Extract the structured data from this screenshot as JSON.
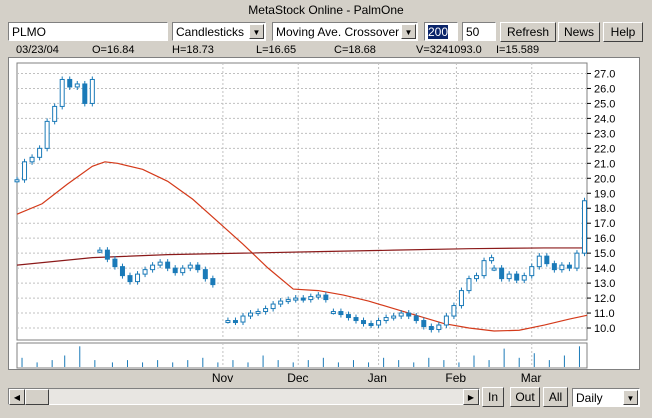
{
  "window": {
    "title": "MetaStock Online - PalmOne"
  },
  "toolbar": {
    "symbol": "PLMO",
    "chart_style": "Candlesticks",
    "indicator": "Moving Ave. Crossover",
    "period1": "200",
    "period2": "50",
    "refresh_label": "Refresh",
    "news_label": "News",
    "help_label": "Help"
  },
  "quote": {
    "date": "03/23/04",
    "open": "O=16.84",
    "high": "H=18.73",
    "low": "L=16.65",
    "close": "C=18.68",
    "volume": "V=3241093.0",
    "indicator": "I=15.589"
  },
  "bottom": {
    "in_label": "In",
    "out_label": "Out",
    "all_label": "All",
    "interval": "Daily"
  },
  "colors": {
    "price": "#1a7ab8",
    "ma_fast": "#d43a1a",
    "ma_slow": "#8b1a1a",
    "grid": "#c0c0c0",
    "volume": "#1a7ab8"
  },
  "chart_data": {
    "type": "line",
    "title": "",
    "xlabel": "",
    "ylabel": "",
    "ylim": [
      9.2,
      27.7
    ],
    "y_ticks": [
      "27.0",
      "26.0",
      "25.0",
      "24.0",
      "23.0",
      "22.0",
      "21.0",
      "20.0",
      "19.0",
      "18.0",
      "17.0",
      "16.0",
      "15.0",
      "14.0",
      "13.0",
      "12.0",
      "11.0",
      "10.0"
    ],
    "x_ticks": [
      "Nov",
      "Dec",
      "Jan",
      "Feb",
      "Mar"
    ],
    "x_tick_days": [
      82,
      112,
      144,
      175,
      205
    ],
    "day_range": [
      0,
      227
    ],
    "grid": true,
    "series": [
      {
        "kind": "ma",
        "color_key": "ma_fast",
        "days": [
          0,
          10,
          20,
          30,
          35,
          40,
          50,
          60,
          70,
          80,
          90,
          100,
          110,
          120,
          130,
          140,
          150,
          160,
          170,
          180,
          190,
          200,
          210,
          220,
          227
        ],
        "values": [
          17.6,
          18.3,
          19.6,
          20.8,
          21.1,
          21.0,
          20.6,
          19.8,
          18.6,
          17.1,
          15.6,
          14.0,
          12.6,
          12.5,
          12.2,
          11.8,
          11.3,
          10.8,
          10.3,
          10.0,
          9.8,
          9.85,
          10.2,
          10.6,
          10.85
        ]
      },
      {
        "kind": "ma",
        "color_key": "ma_slow",
        "days": [
          0,
          30,
          60,
          90,
          120,
          150,
          180,
          210,
          227
        ],
        "values": [
          14.2,
          14.7,
          14.9,
          15.0,
          15.1,
          15.2,
          15.3,
          15.35,
          15.35
        ]
      },
      {
        "kind": "price",
        "color_key": "price",
        "segments": [
          {
            "days": [
              0,
              3,
              6,
              9,
              12,
              15,
              18,
              21,
              24,
              27,
              30
            ],
            "values": [
              19.9,
              21.1,
              21.4,
              22.0,
              23.8,
              24.8,
              26.6,
              26.1,
              26.3,
              25.0,
              26.6
            ]
          },
          {
            "days": [
              33,
              36,
              39,
              42,
              45,
              48,
              51,
              54,
              57,
              60,
              63,
              66,
              69,
              72,
              75,
              78
            ],
            "values": [
              15.2,
              14.6,
              14.1,
              13.5,
              13.1,
              13.6,
              13.9,
              14.2,
              14.4,
              14.0,
              13.7,
              14.0,
              14.2,
              13.9,
              13.3,
              12.9
            ]
          },
          {
            "days": [
              84,
              87,
              90,
              93,
              96,
              99,
              102,
              105,
              108,
              111,
              114,
              117,
              120,
              123
            ],
            "values": [
              10.5,
              10.4,
              10.8,
              11.0,
              11.1,
              11.3,
              11.6,
              11.8,
              11.9,
              12.0,
              11.9,
              12.1,
              12.2,
              11.9
            ]
          },
          {
            "days": [
              126,
              129,
              132,
              135,
              138,
              141,
              144,
              147,
              150,
              153,
              156,
              159,
              162,
              165,
              168,
              171,
              174,
              177,
              180,
              183,
              186,
              189
            ],
            "values": [
              11.1,
              10.9,
              10.7,
              10.5,
              10.3,
              10.2,
              10.5,
              10.7,
              10.8,
              11.0,
              10.8,
              10.5,
              10.1,
              9.9,
              10.2,
              10.8,
              11.5,
              12.5,
              13.3,
              13.5,
              14.5,
              14.7
            ]
          },
          {
            "days": [
              190,
              193,
              196,
              199,
              202,
              205,
              208,
              211,
              214,
              217,
              220,
              223,
              226
            ],
            "values": [
              14.0,
              13.3,
              13.6,
              13.2,
              13.5,
              14.1,
              14.8,
              14.3,
              13.9,
              14.2,
              14.0,
              15.0,
              18.5
            ]
          }
        ]
      },
      {
        "kind": "volume",
        "color_key": "volume",
        "days": [
          2,
          8,
          14,
          19,
          25,
          31,
          38,
          44,
          50,
          56,
          62,
          68,
          74,
          80,
          86,
          92,
          98,
          104,
          110,
          116,
          122,
          128,
          134,
          140,
          146,
          152,
          158,
          164,
          170,
          176,
          182,
          188,
          194,
          200,
          206,
          212,
          218,
          224
        ],
        "values": [
          0.4,
          0.2,
          0.3,
          0.5,
          0.9,
          0.3,
          0.2,
          0.3,
          0.2,
          0.3,
          0.2,
          0.3,
          0.4,
          0.2,
          0.3,
          0.2,
          0.5,
          0.3,
          0.2,
          0.3,
          0.4,
          0.2,
          0.3,
          0.2,
          0.4,
          0.3,
          0.2,
          0.4,
          0.3,
          0.2,
          0.5,
          0.3,
          0.8,
          0.4,
          0.6,
          0.3,
          0.5,
          0.9
        ]
      }
    ]
  }
}
